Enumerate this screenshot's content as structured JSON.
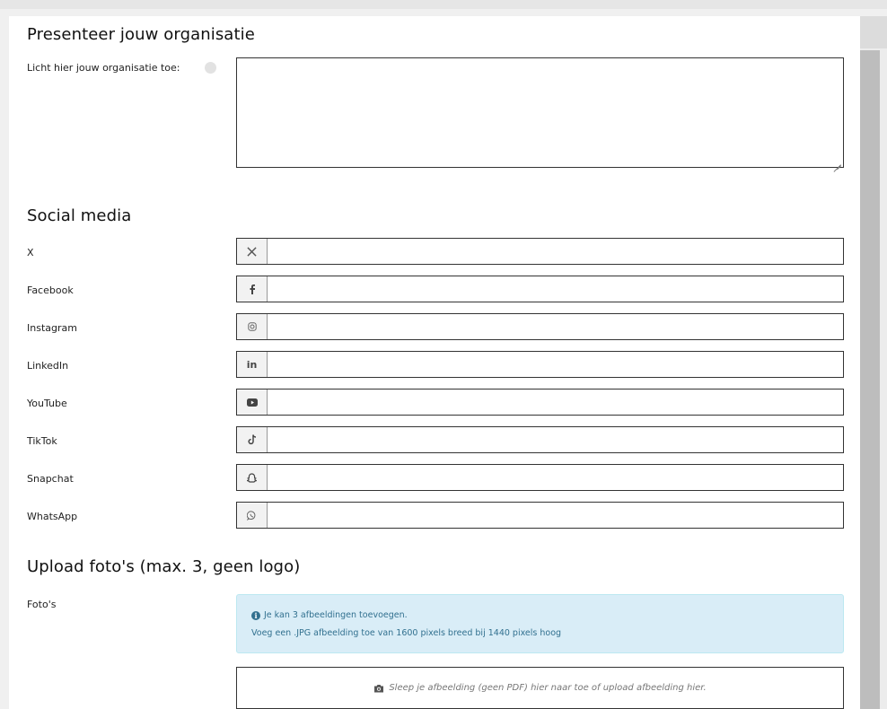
{
  "sections": {
    "presentation_title": "Presenteer jouw organisatie",
    "social_title": "Social media",
    "upload_title": "Upload foto's (max. 3, geen logo)"
  },
  "presentation": {
    "label": "Licht hier jouw organisatie toe:",
    "value": ""
  },
  "social": [
    {
      "label": "X",
      "icon": "x-icon",
      "value": ""
    },
    {
      "label": "Facebook",
      "icon": "facebook-icon",
      "value": ""
    },
    {
      "label": "Instagram",
      "icon": "instagram-icon",
      "value": ""
    },
    {
      "label": "LinkedIn",
      "icon": "linkedin-icon",
      "value": ""
    },
    {
      "label": "YouTube",
      "icon": "youtube-icon",
      "value": ""
    },
    {
      "label": "TikTok",
      "icon": "tiktok-icon",
      "value": ""
    },
    {
      "label": "Snapchat",
      "icon": "snapchat-icon",
      "value": ""
    },
    {
      "label": "WhatsApp",
      "icon": "whatsapp-icon",
      "value": ""
    }
  ],
  "upload": {
    "label": "Foto's",
    "info_line1": "Je kan 3 afbeeldingen toevoegen.",
    "info_line2": "Voeg een .JPG afbeelding toe van 1600 pixels breed bij 1440 pixels hoog",
    "dropzone_text": "Sleep je afbeelding (geen PDF) hier naar toe of upload afbeelding hier."
  },
  "colors": {
    "alert_bg": "#d9edf7",
    "alert_text": "#31708f",
    "border": "#333333"
  }
}
